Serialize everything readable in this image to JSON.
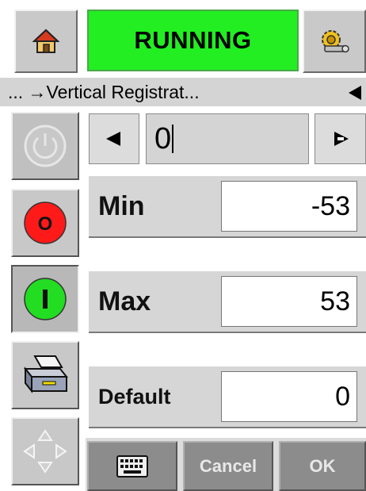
{
  "header": {
    "status_text": "RUNNING",
    "home_icon": "house-icon",
    "settings_icon": "gear-wrench-icon",
    "status_color": "#22ee22"
  },
  "breadcrumb": {
    "text": "... →Vertical Registrat...",
    "back_icon": "left-triangle-icon"
  },
  "sidebar": {
    "items": [
      {
        "name": "power-icon",
        "state": "disabled"
      },
      {
        "name": "stop-icon",
        "label": "O",
        "color": "#ff1a1a"
      },
      {
        "name": "start-icon",
        "label": "I",
        "color": "#22dd22"
      },
      {
        "name": "printer-icon"
      },
      {
        "name": "navigation-arrows-icon"
      }
    ]
  },
  "editor": {
    "value": "0",
    "decrement_icon": "left-arrow-icon",
    "increment_icon": "right-arrow-icon",
    "min_label": "Min",
    "min_value": "-53",
    "max_label": "Max",
    "max_value": "53",
    "default_label": "Default",
    "default_value": "0"
  },
  "bottom_bar": {
    "keyboard_icon": "keyboard-icon",
    "cancel_label": "Cancel",
    "ok_label": "OK"
  }
}
